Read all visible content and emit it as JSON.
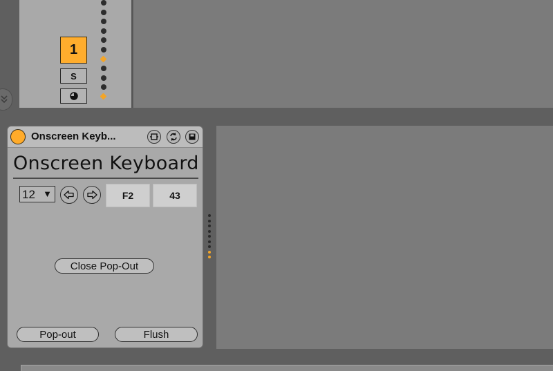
{
  "track": {
    "number_label": "1",
    "solo_label": "S",
    "arm_icon": "half-circle-icon",
    "meter_levels": [
      0,
      0,
      0,
      0,
      0,
      0,
      1,
      0,
      0,
      0,
      1
    ]
  },
  "device": {
    "title": "Onscreen Keyb...",
    "heading": "Onscreen Keyboard",
    "octave_value": "12",
    "octave_arrow": "▼",
    "note_value": "F2",
    "midi_value": "43",
    "close_popout_label": "Close Pop-Out",
    "popout_label": "Pop-out",
    "flush_label": "Flush",
    "header_icons": [
      "fold-icon",
      "hot-swap-icon",
      "save-preset-icon"
    ]
  },
  "side_meter_levels": [
    0,
    0,
    0,
    0,
    0,
    0,
    0,
    1,
    1
  ],
  "colors": {
    "accent": "#ffad2d",
    "panel": "#a9a9a9",
    "background": "#5f5f5f",
    "empty_area": "#7b7b7b"
  }
}
